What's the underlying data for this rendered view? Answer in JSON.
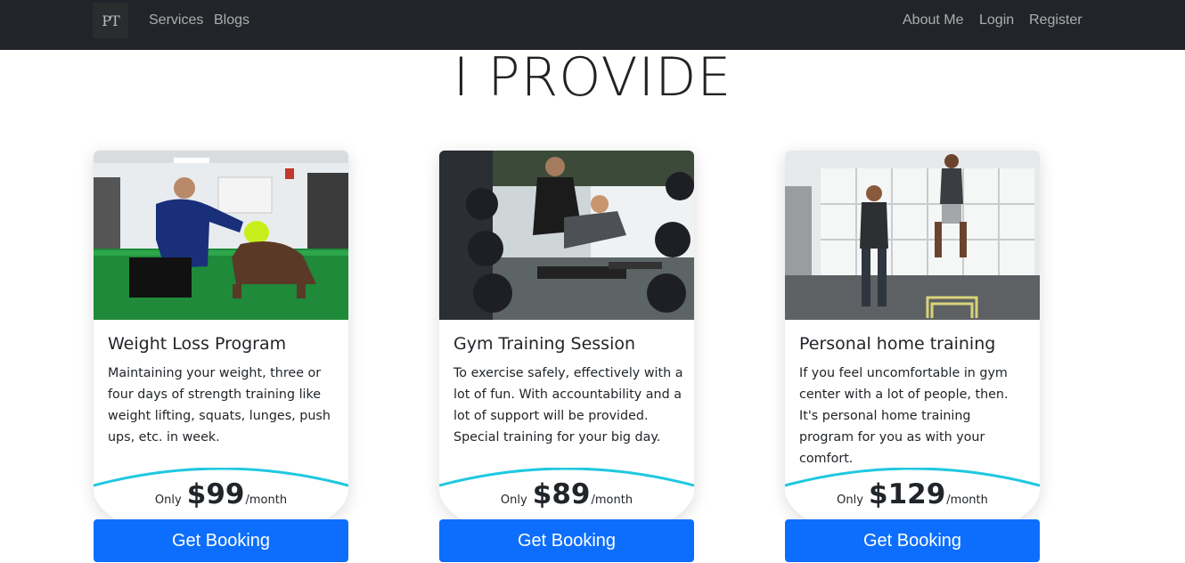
{
  "nav": {
    "brand": "PT",
    "links_left": [
      "Services",
      "Blogs"
    ],
    "links_right": [
      "About Me",
      "Login",
      "Register"
    ]
  },
  "hero": {
    "title": "I PROVIDE"
  },
  "cards": [
    {
      "title": "Weight Loss Program",
      "text": "Maintaining your weight, three or four days of strength training like weight lifting, squats, lunges, push ups, etc. in week.",
      "price_prefix": "Only",
      "price": "$99",
      "price_suffix": "/month",
      "button": "Get Booking"
    },
    {
      "title": "Gym Training Session",
      "text": "To exercise safely, effectively with a lot of fun. With accountability and a lot of support will be provided. Special training for your big day.",
      "price_prefix": "Only",
      "price": "$89",
      "price_suffix": "/month",
      "button": "Get Booking"
    },
    {
      "title": "Personal home training",
      "text": "If you feel uncomfortable in gym center with a lot of people, then. It's personal home training program for you as with your comfort.",
      "price_prefix": "Only",
      "price": "$129",
      "price_suffix": "/month",
      "button": "Get Booking"
    }
  ],
  "colors": {
    "navbar": "#212529",
    "primary": "#0d6efd",
    "arc_accent": "#1ec8e0"
  }
}
